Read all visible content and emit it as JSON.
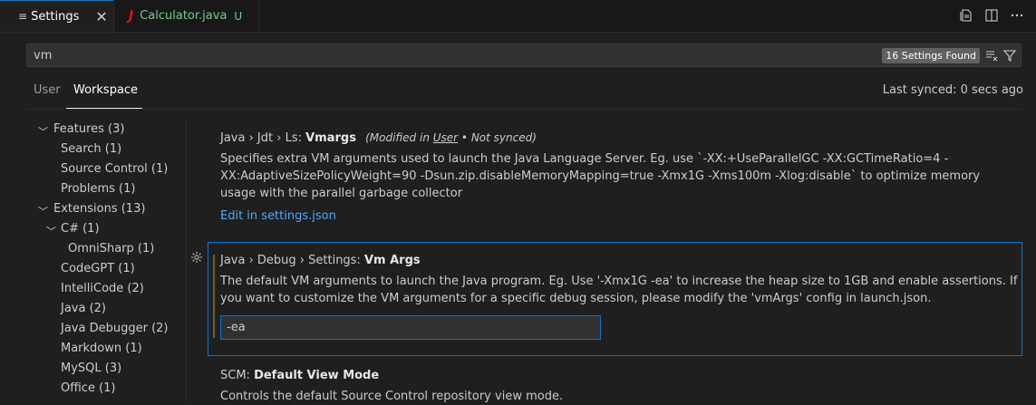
{
  "tabs": {
    "settings_label": "Settings",
    "settings_icon": "≡",
    "close_icon": "✕",
    "calc_icon": "J",
    "calc_label": "Calculator.java",
    "calc_status": "U"
  },
  "search": {
    "value": "vm",
    "found": "16 Settings Found"
  },
  "scope": {
    "user": "User",
    "workspace": "Workspace",
    "last_synced": "Last synced: 0 secs ago"
  },
  "toc": [
    {
      "label": "Features (3)",
      "expanded": true
    },
    {
      "label": "Search (1)"
    },
    {
      "label": "Source Control (1)"
    },
    {
      "label": "Problems (1)"
    },
    {
      "label": "Extensions (13)",
      "expanded": true
    },
    {
      "label": "C# (1)",
      "expanded": true
    },
    {
      "label": "OmniSharp (1)"
    },
    {
      "label": "CodeGPT (1)"
    },
    {
      "label": "IntelliCode (2)"
    },
    {
      "label": "Java (2)"
    },
    {
      "label": "Java Debugger (2)"
    },
    {
      "label": "Markdown (1)"
    },
    {
      "label": "MySQL (3)"
    },
    {
      "label": "Office (1)"
    }
  ],
  "settings": {
    "vmargs": {
      "prefix": "Java › Jdt › Ls: ",
      "name": "Vmargs",
      "mod_before": "(Modified in ",
      "mod_link": "User",
      "mod_after": " • Not synced)",
      "desc": "Specifies extra VM arguments used to launch the Java Language Server. Eg. use `-XX:+UseParallelGC -XX:GCTimeRatio=4 -XX:AdaptiveSizePolicyWeight=90 -Dsun.zip.disableMemoryMapping=true -Xmx1G -Xms100m -Xlog:disable` to optimize memory usage with the parallel garbage collector",
      "edit_link": "Edit in settings.json"
    },
    "debug_vmargs": {
      "prefix": "Java › Debug › Settings: ",
      "name": "Vm Args",
      "desc": "The default VM arguments to launch the Java program. Eg. Use '-Xmx1G -ea' to increase the heap size to 1GB and enable assertions. If you want to customize the VM arguments for a specific debug session, please modify the 'vmArgs' config in launch.json.",
      "value": "-ea"
    },
    "scm": {
      "prefix": "SCM: ",
      "name": "Default View Mode",
      "desc": "Controls the default Source Control repository view mode."
    }
  },
  "colors": {
    "accent": "#0078d4",
    "link": "#4daafc",
    "untracked": "#73c991",
    "java": "#e51400"
  }
}
